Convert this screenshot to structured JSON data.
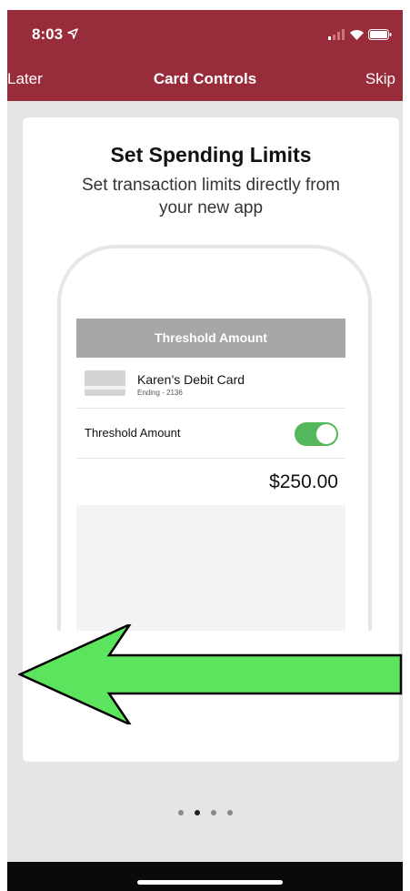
{
  "status_bar": {
    "time": "8:03"
  },
  "nav": {
    "left_label": "Later",
    "title": "Card Controls",
    "right_label": "Skip"
  },
  "card": {
    "title": "Set Spending Limits",
    "subtitle": "Set transaction limits directly from your new app"
  },
  "preview": {
    "header": "Threshold Amount",
    "card_name": "Karen’s Debit Card",
    "card_ending": "Ending - 2136",
    "threshold_label": "Threshold Amount",
    "toggle_on": true,
    "amount": "$250.00"
  },
  "pager": {
    "total": 4,
    "active_index": 1
  },
  "colors": {
    "brand": "#992c3a",
    "toggle": "#54b75c",
    "arrow": "#5de45f"
  }
}
